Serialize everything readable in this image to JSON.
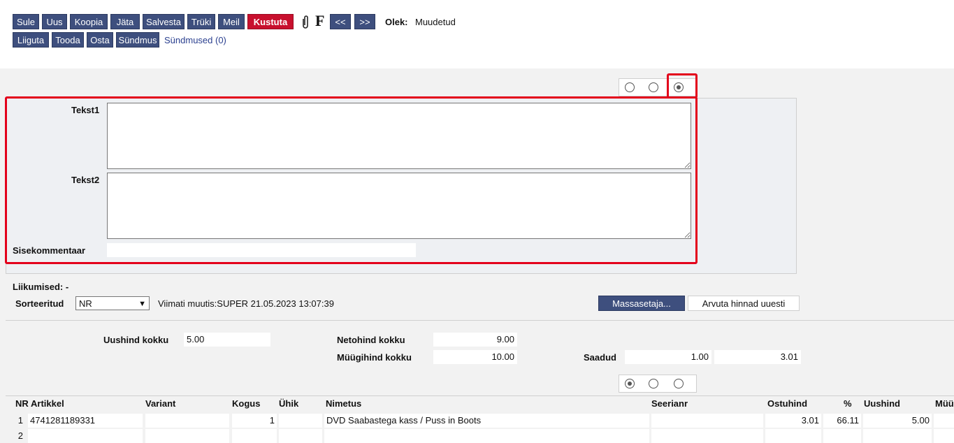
{
  "toolbar": {
    "sule": "Sule",
    "uus": "Uus",
    "koopia": "Koopia",
    "jata": "Jäta",
    "salvesta": "Salvesta",
    "truki": "Trüki",
    "meil": "Meil",
    "kustuta": "Kustuta",
    "f_label": "F",
    "prev": "<<",
    "next": ">>",
    "olek_label": "Olek:",
    "olek_value": "Muudetud",
    "liiguta": "Liiguta",
    "tooda": "Tooda",
    "osta": "Osta",
    "sundmus": "Sündmus",
    "sundmused_link": "Sündmused (0)"
  },
  "comments": {
    "tekst1_label": "Tekst1",
    "tekst1_value": "",
    "tekst2_label": "Tekst2",
    "tekst2_value": "",
    "sisekommentaar_label": "Sisekommentaar",
    "sisekommentaar_value": ""
  },
  "movements": {
    "liikumised": "Liikumised: -",
    "sorteeritud_label": "Sorteeritud",
    "sorteeritud_value": "NR",
    "viimati_muutis": "Viimati muutis:SUPER 21.05.2023 13:07:39",
    "massasetaja": "Massasetaja...",
    "arvuta": "Arvuta hinnad uuesti"
  },
  "totals": {
    "uushind_label": "Uushind kokku",
    "uushind_value": "5.00",
    "netohind_label": "Netohind kokku",
    "netohind_value": "9.00",
    "myygihind_label": "Müügihind kokku",
    "myygihind_value": "10.00",
    "saadud_label": "Saadud",
    "saadud_value1": "1.00",
    "saadud_value2": "3.01"
  },
  "table": {
    "headers": {
      "nr": "NR",
      "artikkel": "Artikkel",
      "variant": "Variant",
      "kogus": "Kogus",
      "uhik": "Ühik",
      "nimetus": "Nimetus",
      "seerianr": "Seerianr",
      "ostuhind": "Ostuhind",
      "pct": "%",
      "uushind": "Uushind",
      "myyk": "Müü"
    },
    "rows": [
      {
        "nr": "1",
        "artikkel": "4741281189331",
        "variant": "",
        "kogus": "1",
        "uhik": "",
        "nimetus": "DVD Saabastega kass / Puss in Boots",
        "seerianr": "",
        "ostuhind": "3.01",
        "pct": "66.11",
        "uushind": "5.00",
        "myyk": ""
      },
      {
        "nr": "2",
        "artikkel": "",
        "variant": "",
        "kogus": "",
        "uhik": "",
        "nimetus": "",
        "seerianr": "",
        "ostuhind": "",
        "pct": "",
        "uushind": "",
        "myyk": ""
      }
    ]
  },
  "colors": {
    "button": "#3e4f7e",
    "delete": "#c8102e",
    "highlight": "#e3001b"
  },
  "icons": [
    "paperclip-icon",
    "radio-icon",
    "dropdown-chevron-icon",
    "resize-grip-icon"
  ]
}
